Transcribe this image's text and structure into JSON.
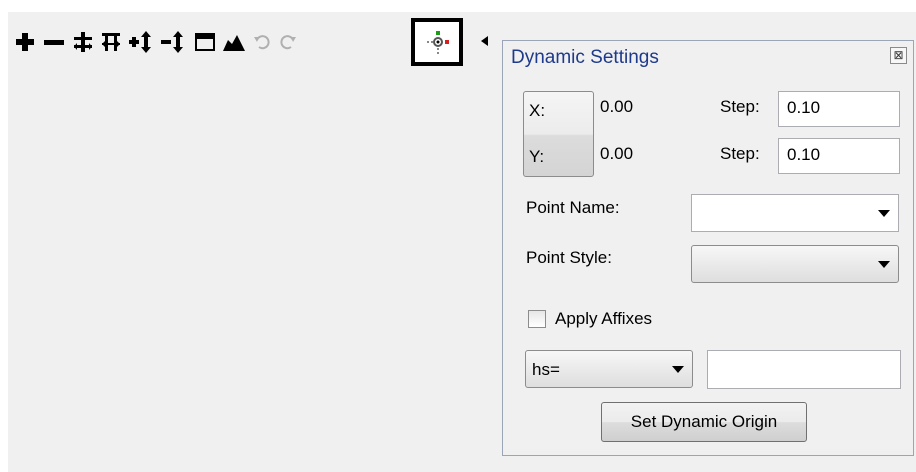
{
  "toolbar": {
    "icons": [
      "plus-icon",
      "minus-icon",
      "insert-row-icon",
      "insert-col-icon",
      "add-row-icon",
      "remove-row-icon",
      "window-icon",
      "terrain-icon",
      "undo-icon",
      "redo-icon",
      "dynamic-point-icon",
      "collapse-left-icon"
    ]
  },
  "dialog": {
    "title": "Dynamic Settings",
    "close_glyph": "⊠",
    "x_label": "X:",
    "y_label": "Y:",
    "x_value": "0.00",
    "y_value": "0.00",
    "step_label_1": "Step:",
    "step_label_2": "Step:",
    "step_value_1": "0.10",
    "step_value_2": "0.10",
    "point_name_label": "Point Name:",
    "point_name_value": "",
    "point_style_label": "Point Style:",
    "point_style_value": "",
    "apply_affixes_label": "Apply Affixes",
    "apply_affixes_checked": false,
    "affix_select_value": "hs=",
    "affix_text_value": "",
    "set_origin_button": "Set Dynamic Origin"
  },
  "colors": {
    "title": "#1e3a8a",
    "highlight_border": "#000000",
    "green_dot": "#1a9e1a",
    "red_dot": "#d42020"
  }
}
